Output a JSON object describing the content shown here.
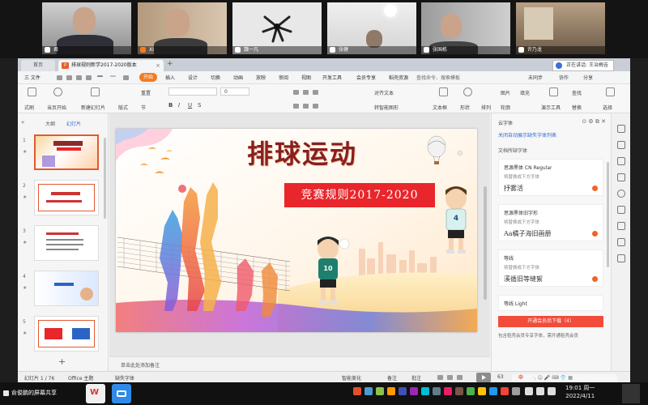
{
  "meeting": {
    "participants": [
      {
        "name": "君"
      },
      {
        "name": "XI"
      },
      {
        "name": "魏一凡"
      },
      {
        "name": "张健"
      },
      {
        "name": "张国栋"
      },
      {
        "name": "许乃龙"
      }
    ],
    "speaking": "正在讲话: 王治梅吉",
    "share_label": "俞俊鹏的屏幕共享"
  },
  "window": {
    "home_tab": "首页",
    "doc_tab": "排球规则新学2017-2020版本",
    "doc_icon": "P",
    "close_tab": "×",
    "new_tab": "+"
  },
  "menu": {
    "file": "三 文件",
    "start": "开始",
    "items": [
      "插入",
      "设计",
      "切换",
      "动画",
      "放映",
      "审阅",
      "视图",
      "开发工具",
      "会员专享",
      "稻壳资源"
    ],
    "search": "查找命令、搜索模板",
    "unsynced": "未同步",
    "collab": "协作",
    "share": "分享"
  },
  "ribbon": {
    "format_painter": "式刷",
    "from_current": "当页开始",
    "new_slide": "新建幻灯片",
    "layout": "版式",
    "section": "节",
    "reset": "重置",
    "font_size": "0",
    "align_text": "对齐文本",
    "smart_graphic": "转智能图形",
    "textbox": "文本框",
    "shape": "形状",
    "arrange": "排列",
    "picture": "图片",
    "fill": "填充",
    "outline": "轮廓",
    "present_tools": "演示工具",
    "find": "查找",
    "replace": "替换",
    "select": "选择"
  },
  "left_panel": {
    "outline_tab": "大纲",
    "slides_tab": "幻灯片",
    "collapse": "«",
    "slide_numbers": [
      "1",
      "2",
      "3",
      "4",
      "5"
    ],
    "add": "+"
  },
  "slide": {
    "title": "排球运动",
    "subtitle": "竞赛规则2017-2020",
    "player_number_left": "10",
    "player_number_right": "4"
  },
  "notes": {
    "placeholder": "单击此处添加备注"
  },
  "right_panel": {
    "title": "云字体",
    "link": "关闭自动展示缺失字体列表",
    "section": "文档所缺字体",
    "fonts": [
      {
        "name": "思源黑体 CN Regular",
        "replace": "将替换成下方字体",
        "sample": "抒雾活"
      },
      {
        "name": "思源黑体旧字形",
        "replace": "将替换成下方字体",
        "sample": "Aa橘子海旧画册"
      },
      {
        "name": "等线",
        "replace": "将替换成下方字体",
        "sample": "溪循旧等缝絮"
      },
      {
        "name": "等线 Light",
        "replace": "",
        "sample": ""
      }
    ],
    "download_btn": "开通会员后下载（4）",
    "note": "包含稻壳会员专享字体，需开通稻壳会员"
  },
  "status": {
    "slide_count": "幻灯片 1 / 76",
    "theme": "Office 主题",
    "missing_font": "缺失字体",
    "beautify": "智能美化",
    "notes": "备注",
    "comments": "批注",
    "zoom": "63"
  },
  "taskbar": {
    "time": "19:01 周一",
    "date": "2022/4/11",
    "ime": "中"
  },
  "colors": {
    "accent_orange": "#f47c20",
    "download_red": "#f24b3a",
    "link_blue": "#2d6bd3",
    "title_red": "#e8262b"
  }
}
